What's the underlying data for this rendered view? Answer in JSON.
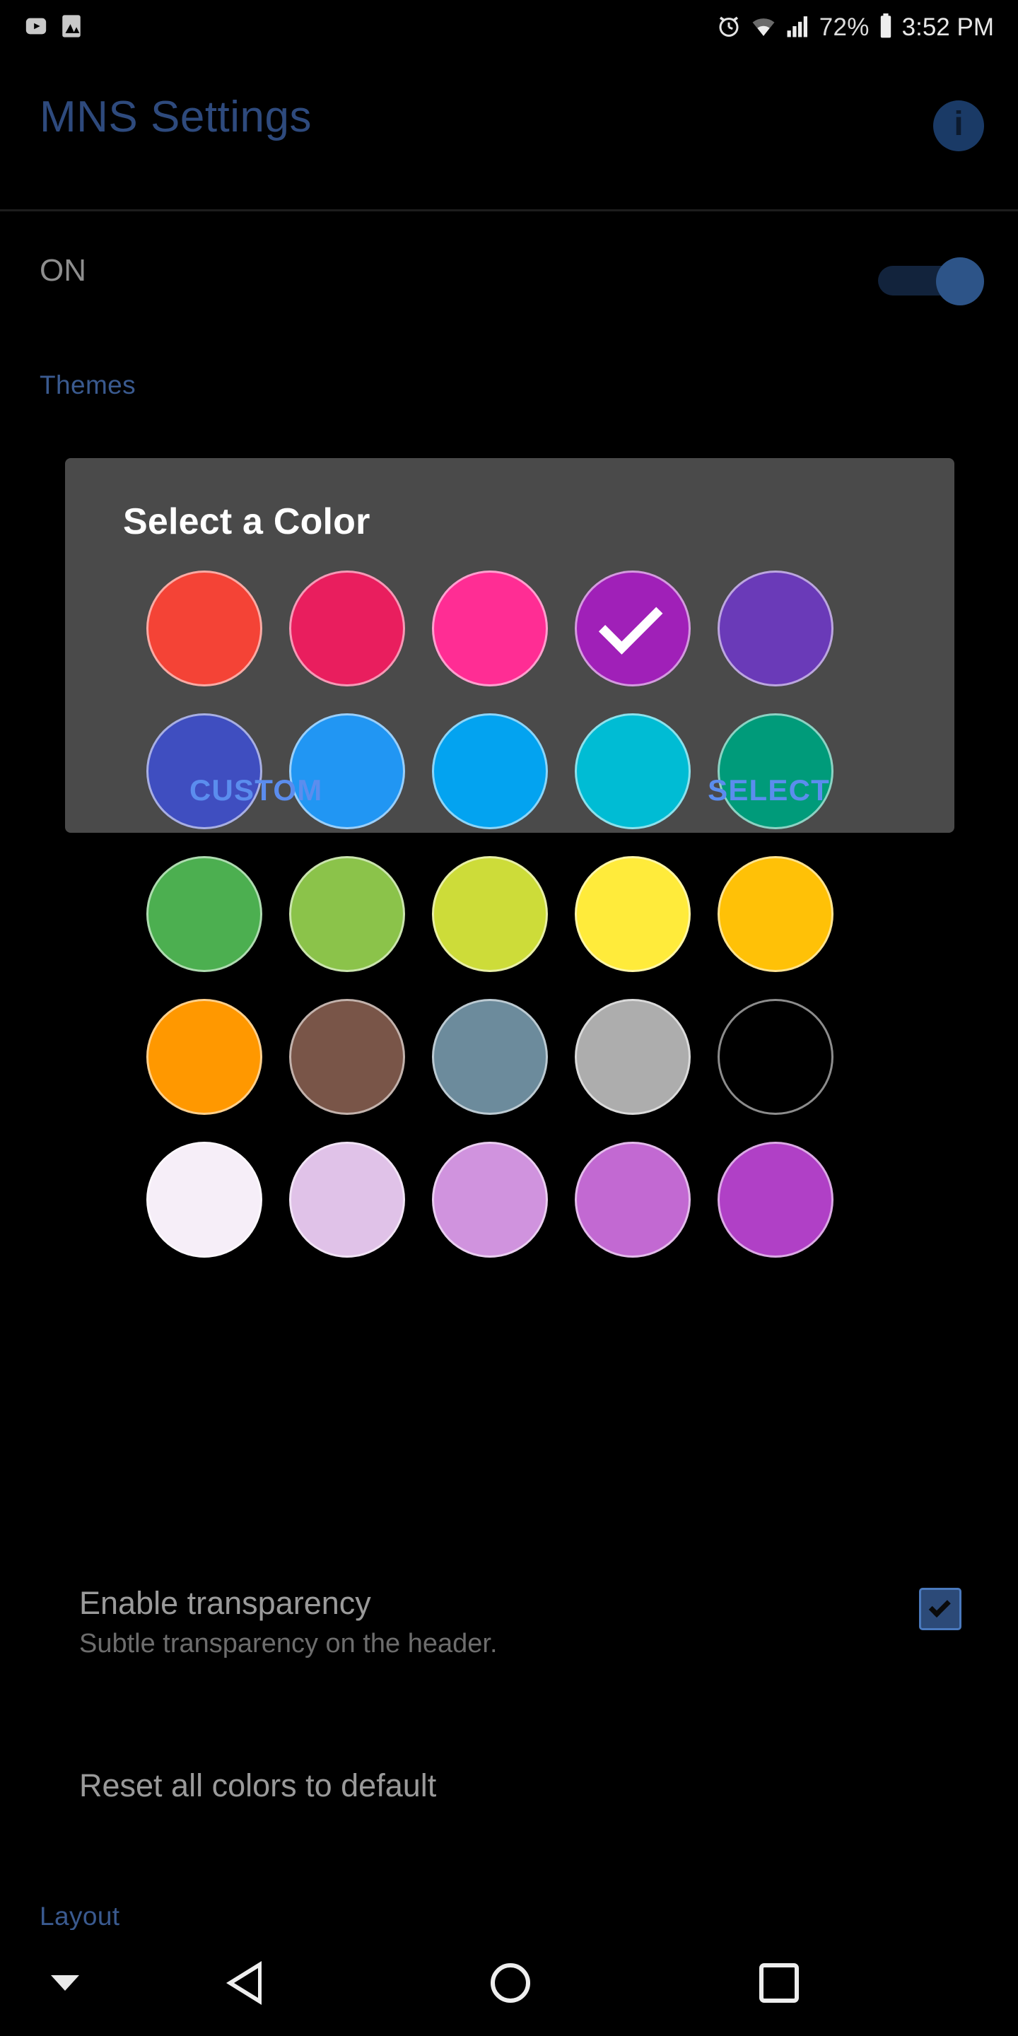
{
  "status_bar": {
    "left_icons": [
      {
        "name": "youtube-icon",
        "label": "YouTube"
      },
      {
        "name": "image-icon",
        "label": "Screenshot"
      }
    ],
    "right_icons": [
      {
        "name": "alarm-icon",
        "label": "Alarm"
      },
      {
        "name": "wifi-icon",
        "label": "Wi-Fi"
      },
      {
        "name": "signal-icon",
        "label": "Signal"
      }
    ],
    "battery_percent": "72%",
    "battery_icon": "battery-icon",
    "time": "3:52 PM"
  },
  "app_bar": {
    "title": "MNS Settings",
    "title_color": "#2e4a7d",
    "info_icon": "info-icon",
    "info_glyph": "i"
  },
  "master_switch": {
    "label": "ON",
    "state": "on",
    "track_color": "#12233c",
    "thumb_color": "#2d5488"
  },
  "sections": {
    "themes": "Themes",
    "layout": "Layout"
  },
  "dialog": {
    "title": "Select a Color",
    "background": "#4a4a4a",
    "selected_index": 3,
    "check_icon": "check-icon",
    "buttons": {
      "custom": "CUSTOM",
      "select": "SELECT",
      "color": "#5b8dee"
    },
    "swatch_rows": [
      [
        {
          "name": "red",
          "hex": "#F44336"
        },
        {
          "name": "crimson",
          "hex": "#E91E5E"
        },
        {
          "name": "hot-pink",
          "hex": "#FF2D94"
        },
        {
          "name": "purple",
          "hex": "#A020B8"
        },
        {
          "name": "deep-purple",
          "hex": "#6A3AB8"
        }
      ],
      [
        {
          "name": "indigo",
          "hex": "#3F4EC0"
        },
        {
          "name": "blue",
          "hex": "#2196F3"
        },
        {
          "name": "light-blue",
          "hex": "#03A3F0"
        },
        {
          "name": "cyan",
          "hex": "#00BCD4"
        },
        {
          "name": "teal",
          "hex": "#009B7A"
        }
      ],
      [
        {
          "name": "green",
          "hex": "#4CAF50"
        },
        {
          "name": "light-green",
          "hex": "#8BC34A"
        },
        {
          "name": "lime",
          "hex": "#CDDC39"
        },
        {
          "name": "yellow",
          "hex": "#FFEB3B"
        },
        {
          "name": "amber",
          "hex": "#FFC107"
        }
      ],
      [
        {
          "name": "orange",
          "hex": "#FF9800"
        },
        {
          "name": "brown",
          "hex": "#795548"
        },
        {
          "name": "blue-grey",
          "hex": "#6C8B9C"
        },
        {
          "name": "grey",
          "hex": "#ADADAD"
        },
        {
          "name": "black",
          "hex": "#000000"
        }
      ],
      [
        {
          "name": "purple-tint-95",
          "hex": "#F6EEF8"
        },
        {
          "name": "purple-tint-75",
          "hex": "#E0C2E8"
        },
        {
          "name": "purple-tint-55",
          "hex": "#D093DE"
        },
        {
          "name": "purple-tint-35",
          "hex": "#C269D2"
        },
        {
          "name": "purple-tint-15",
          "hex": "#B040C6"
        }
      ]
    ]
  },
  "preferences": [
    {
      "name": "enable-transparency",
      "title": "Enable transparency",
      "subtitle": "Subtle transparency on the header.",
      "checkbox_checked": true
    },
    {
      "name": "reset-all-colors",
      "title": "Reset all colors to default",
      "subtitle": ""
    }
  ],
  "nav_bar": {
    "hide_keyboard_icon": "chevron-down-icon",
    "back_icon": "back-triangle-icon",
    "home_icon": "home-circle-icon",
    "recents_icon": "recents-square-icon"
  }
}
